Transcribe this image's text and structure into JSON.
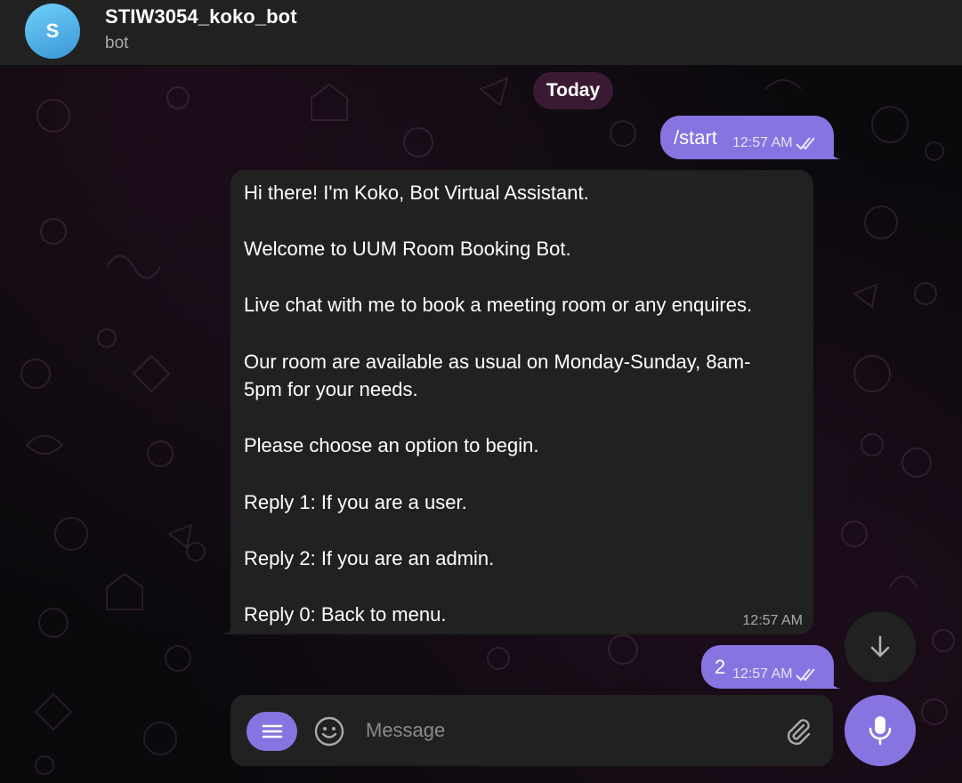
{
  "header": {
    "avatar_letter": "S",
    "title": "STIW3054_koko_bot",
    "subtitle": "bot"
  },
  "date_separator": "Today",
  "messages": [
    {
      "direction": "outgoing",
      "text": "/start",
      "time": "12:57 AM",
      "status": "read"
    },
    {
      "direction": "incoming",
      "lines": [
        "Hi there! I'm Koko, Bot Virtual Assistant.",
        "",
        "Welcome to UUM Room Booking Bot.",
        "",
        "Live chat with me to book a meeting room or any enquires.",
        "",
        "Our room are available as usual on Monday-Sunday, 8am-",
        "5pm for your needs.",
        "",
        "Please choose an option to begin.",
        "",
        "Reply 1: If you are a user.",
        "",
        "Reply 2: If you are an admin.",
        "",
        "Reply 0: Back to menu."
      ],
      "time": "12:57 AM"
    },
    {
      "direction": "outgoing",
      "text": "2",
      "time": "12:57 AM",
      "status": "read"
    }
  ],
  "composer": {
    "placeholder": "Message"
  },
  "icons": {
    "menu": "menu-icon",
    "emoji": "smile-icon",
    "attach": "paperclip-icon",
    "mic": "microphone-icon",
    "scroll_down": "arrow-down-icon",
    "read_status": "double-check-icon"
  },
  "colors": {
    "accent": "#8774e1",
    "header_bg": "#212121",
    "bubble_in": "#212121",
    "date_pill": "#3a1a33"
  }
}
